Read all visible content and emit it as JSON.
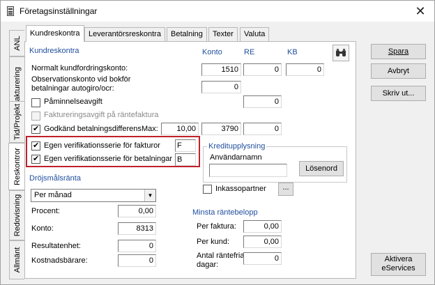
{
  "window": {
    "title": "Företagsinställningar"
  },
  "side_tabs": [
    "ANL",
    "Fakturering",
    "Tid/Projekt",
    "Reskontror",
    "Redovisning",
    "Allmänt"
  ],
  "tabs": [
    "Kundreskontra",
    "Leverantörsreskontra",
    "Betalning",
    "Texter",
    "Valuta"
  ],
  "section": {
    "title": "Kundreskontra",
    "col_konto": "Konto",
    "col_re": "RE",
    "col_kb": "KB"
  },
  "rows": {
    "normalt_label": "Normalt kundfordringskonto:",
    "normalt_konto": "1510",
    "normalt_re": "0",
    "normalt_kb": "0",
    "obs_label1": "Observationskonto vid bokför",
    "obs_label2": "betalningar autogiro/ocr:",
    "obs_konto": "0",
    "pamin_label": "Påminnelseavgift",
    "pamin_re": "0",
    "fakt_label": "Faktureringsavgift på räntefaktura",
    "godk_label": "Godkänd betalningsdifferens",
    "godk_max_label": "Max:",
    "godk_max": "10,00",
    "godk_konto": "3790",
    "godk_re": "0",
    "ver_fakt_label": "Egen verifikationsserie för fakturor",
    "ver_fakt": "F",
    "ver_bet_label": "Egen verifikationsserie för betalningar",
    "ver_bet": "B"
  },
  "kredit": {
    "title": "Kreditupplysning",
    "user_label": "Användarnamn",
    "user_value": "",
    "password_button": "Lösenord",
    "inkasso_label": "Inkassopartner",
    "dots_button": "..."
  },
  "drojsmal": {
    "title": "Dröjsmålsränta",
    "period": "Per månad",
    "procent_label": "Procent:",
    "procent": "0,00",
    "konto_label": "Konto:",
    "konto": "8313",
    "resultat_label": "Resultatenhet:",
    "resultat": "0",
    "kostnad_label": "Kostnadsbärare:",
    "kostnad": "0"
  },
  "minsta": {
    "title": "Minsta räntebelopp",
    "per_faktura_label": "Per faktura:",
    "per_faktura": "0,00",
    "per_kund_label": "Per kund:",
    "per_kund": "0,00",
    "antal_label1": "Antal räntefria",
    "antal_label2": "dagar:",
    "antal": "0"
  },
  "buttons": {
    "spara": "Spara",
    "avbryt": "Avbryt",
    "skriv_ut": "Skriv ut...",
    "aktivera1": "Aktivera",
    "aktivera2": "eServices"
  }
}
